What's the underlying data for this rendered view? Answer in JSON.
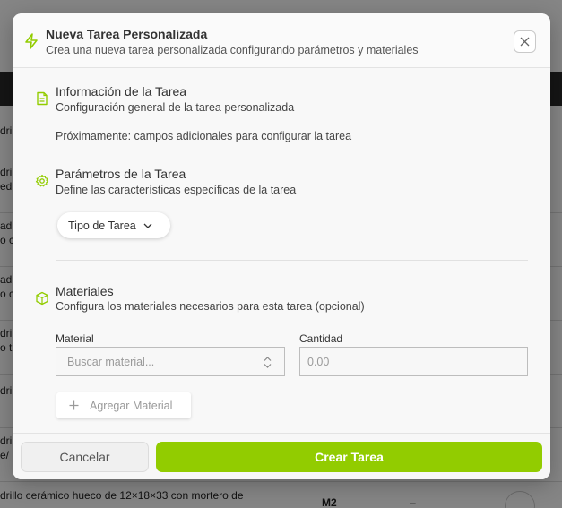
{
  "background": {
    "rows": [
      {
        "line1": "drill",
        "line2": ""
      },
      {
        "line1": "drill",
        "line2": "edit"
      },
      {
        "line1": "adrill",
        "line2": "o c"
      },
      {
        "line1": "adrill",
        "line2": "o c"
      },
      {
        "line1": "drill",
        "line2": "o t"
      },
      {
        "line1": "drill",
        "line2": ""
      },
      {
        "line1": "drill",
        "line2": "e/"
      }
    ],
    "bottom_text_1": "drillo cerámico hueco de 12×18×33 con mortero de",
    "bottom_text_2": "",
    "bottom_unit": "M2",
    "bottom_dash": "–"
  },
  "modal": {
    "title": "Nueva Tarea Personalizada",
    "subtitle": "Crea una nueva tarea personalizada configurando parámetros y materiales",
    "info": {
      "title": "Información de la Tarea",
      "subtitle": "Configuración general de la tarea personalizada",
      "soon": "Próximamente: campos adicionales para configurar la tarea"
    },
    "params": {
      "title": "Parámetros de la Tarea",
      "subtitle": "Define las características específicas de la tarea",
      "task_type_label": "Tipo de Tarea"
    },
    "materials": {
      "title": "Materiales",
      "subtitle": "Configura los materiales necesarios para esta tarea (opcional)",
      "material_label": "Material",
      "material_placeholder": "Buscar material...",
      "quantity_label": "Cantidad",
      "quantity_placeholder": "0.00",
      "add_label": "Agregar Material"
    },
    "footer": {
      "cancel_label": "Cancelar",
      "create_label": "Crear Tarea"
    }
  },
  "colors": {
    "accent": "#92cc00",
    "overlay": "rgba(0,0,0,0.48)"
  }
}
